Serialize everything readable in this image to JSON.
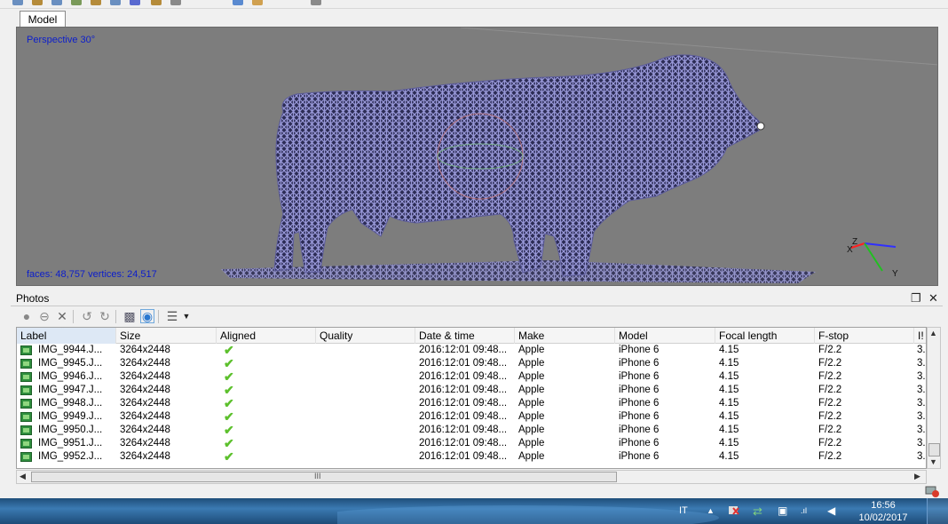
{
  "tabs": {
    "model": "Model"
  },
  "viewport": {
    "projection_label": "Perspective 30°",
    "stats": "faces: 48,757 vertices: 24,517",
    "axis_labels": {
      "x": "X",
      "y": "Y",
      "z": "Z"
    }
  },
  "photos": {
    "title": "Photos",
    "controls": {
      "restore_icon": "restore-icon",
      "close": "✕"
    },
    "toolbar_icons": [
      "enable-icon",
      "disable-icon",
      "remove-icon",
      "rotate-left-icon",
      "rotate-right-icon",
      "find-icon",
      "reset-view-icon",
      "view-details-icon",
      "dropdown-arrow-icon"
    ],
    "columns": [
      "Label",
      "Size",
      "Aligned",
      "Quality",
      "Date & time",
      "Make",
      "Model",
      "Focal length",
      "F-stop",
      "I!"
    ],
    "rows": [
      {
        "label": "IMG_9944.J...",
        "size": "3264x2448",
        "aligned": true,
        "quality": "",
        "datetime": "2016:12:01 09:48...",
        "make": "Apple",
        "model": "iPhone 6",
        "focal": "4.15",
        "fstop": "F/2.2",
        "iso": "3."
      },
      {
        "label": "IMG_9945.J...",
        "size": "3264x2448",
        "aligned": true,
        "quality": "",
        "datetime": "2016:12:01 09:48...",
        "make": "Apple",
        "model": "iPhone 6",
        "focal": "4.15",
        "fstop": "F/2.2",
        "iso": "3."
      },
      {
        "label": "IMG_9946.J...",
        "size": "3264x2448",
        "aligned": true,
        "quality": "",
        "datetime": "2016:12:01 09:48...",
        "make": "Apple",
        "model": "iPhone 6",
        "focal": "4.15",
        "fstop": "F/2.2",
        "iso": "3."
      },
      {
        "label": "IMG_9947.J...",
        "size": "3264x2448",
        "aligned": true,
        "quality": "",
        "datetime": "2016:12:01 09:48...",
        "make": "Apple",
        "model": "iPhone 6",
        "focal": "4.15",
        "fstop": "F/2.2",
        "iso": "3."
      },
      {
        "label": "IMG_9948.J...",
        "size": "3264x2448",
        "aligned": true,
        "quality": "",
        "datetime": "2016:12:01 09:48...",
        "make": "Apple",
        "model": "iPhone 6",
        "focal": "4.15",
        "fstop": "F/2.2",
        "iso": "3."
      },
      {
        "label": "IMG_9949.J...",
        "size": "3264x2448",
        "aligned": true,
        "quality": "",
        "datetime": "2016:12:01 09:48...",
        "make": "Apple",
        "model": "iPhone 6",
        "focal": "4.15",
        "fstop": "F/2.2",
        "iso": "3."
      },
      {
        "label": "IMG_9950.J...",
        "size": "3264x2448",
        "aligned": true,
        "quality": "",
        "datetime": "2016:12:01 09:48...",
        "make": "Apple",
        "model": "iPhone 6",
        "focal": "4.15",
        "fstop": "F/2.2",
        "iso": "3."
      },
      {
        "label": "IMG_9951.J...",
        "size": "3264x2448",
        "aligned": true,
        "quality": "",
        "datetime": "2016:12:01 09:48...",
        "make": "Apple",
        "model": "iPhone 6",
        "focal": "4.15",
        "fstop": "F/2.2",
        "iso": "3."
      },
      {
        "label": "IMG_9952.J...",
        "size": "3264x2448",
        "aligned": true,
        "quality": "",
        "datetime": "2016:12:01 09:48...",
        "make": "Apple",
        "model": "iPhone 6",
        "focal": "4.15",
        "fstop": "F/2.2",
        "iso": "3."
      }
    ],
    "hscroll_grip": "III"
  },
  "taskbar": {
    "language": "IT",
    "tray_icons": [
      "show-hidden-icons-icon",
      "action-center-flag-icon",
      "sync-icon",
      "device-icon",
      "signal-icon",
      "volume-icon"
    ],
    "time": "16:56",
    "date": "10/02/2017"
  },
  "colors": {
    "viewport_bg": "#7d7d7d",
    "mesh": "#8c8ccc",
    "overlay_text": "#0b1dcc",
    "check": "#5cc02c"
  }
}
